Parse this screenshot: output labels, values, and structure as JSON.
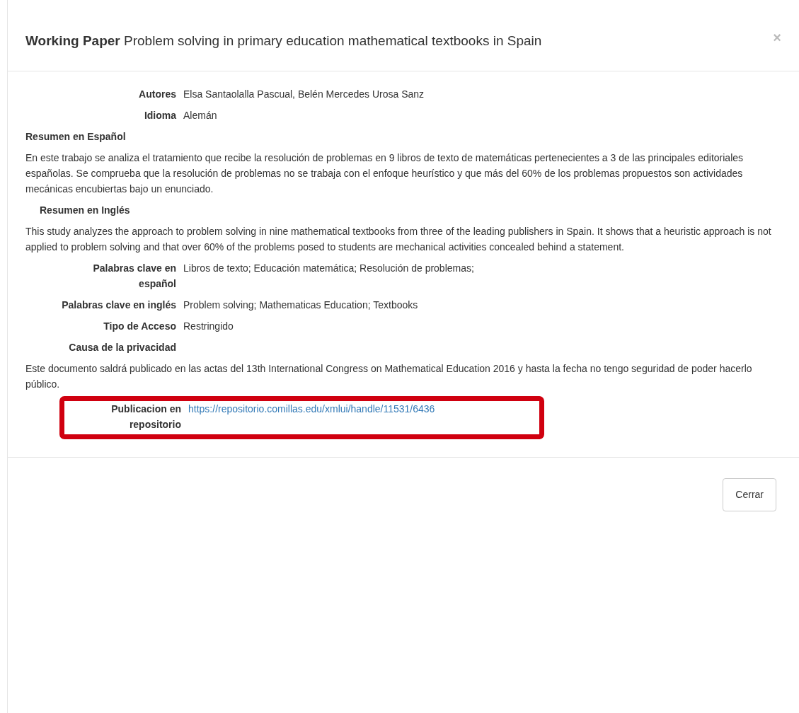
{
  "modal": {
    "title_kind": "Working Paper",
    "title": "Problem solving in primary education mathematical textbooks in Spain",
    "close": "×"
  },
  "fields": [
    {
      "kind": "pair",
      "label": "Autores",
      "value": "Elsa Santaolalla Pascual, Belén Mercedes Urosa Sanz"
    },
    {
      "kind": "pair",
      "label": "Idioma",
      "value": "Alemán"
    },
    {
      "kind": "heading",
      "label": "Resumen en Español"
    },
    {
      "kind": "paragraph",
      "text": "En este trabajo se analiza el tratamiento que recibe la resolución de problemas en 9 libros de texto de matemáticas pertenecientes a 3 de las principales editoriales españolas. Se comprueba que la resolución de problemas no se trabaja con el enfoque heurístico y que más del 60% de los problemas propuestos son actividades mecánicas encubiertas bajo un enunciado."
    },
    {
      "kind": "heading",
      "label": "Resumen en Inglés"
    },
    {
      "kind": "paragraph",
      "text": "This study analyzes the approach to problem solving in nine mathematical textbooks from three of the leading publishers in Spain. It shows that a heuristic approach is not applied to problem solving and that over 60% of the problems posed to students are mechanical activities concealed behind a statement."
    },
    {
      "kind": "pair",
      "label": "Palabras clave en español",
      "value": "Libros de texto; Educación matemática; Resolución de problemas;"
    },
    {
      "kind": "pair",
      "label": "Palabras clave en inglés",
      "value": "Problem solving; Mathematicas Education; Textbooks"
    },
    {
      "kind": "pair",
      "label": "Tipo de Acceso",
      "value": "Restringido"
    },
    {
      "kind": "pair",
      "label": "Causa de la privacidad"
    },
    {
      "kind": "paragraph",
      "text": "Este documento saldrá publicado en las actas del 13th International Congress on Mathematical Education 2016 y hasta la fecha no tengo seguridad de poder hacerlo público."
    },
    {
      "kind": "link",
      "label": "Publicacion en repositorio",
      "value": "https://repositorio.comillas.edu/xmlui/handle/11531/6436",
      "highlighted": true
    }
  ],
  "footer": {
    "button": "Cerrar"
  }
}
